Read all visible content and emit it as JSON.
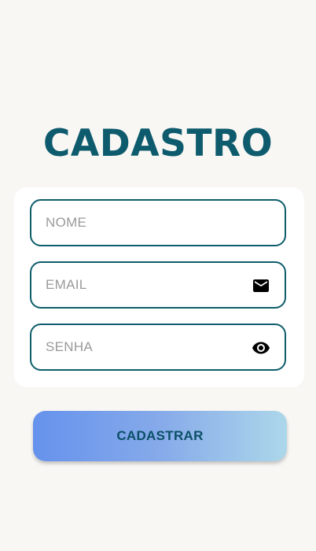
{
  "page": {
    "title": "CADASTRO"
  },
  "form": {
    "name_field": {
      "placeholder": "NOME",
      "value": ""
    },
    "email_field": {
      "placeholder": "EMAIL",
      "value": "",
      "icon": "mail-icon"
    },
    "password_field": {
      "placeholder": "SENHA",
      "value": "",
      "icon": "eye-icon"
    }
  },
  "actions": {
    "submit_label": "CADASTRAR"
  },
  "colors": {
    "background": "#f9f7f4",
    "title": "#0d5b6d",
    "field_border": "#0f5d6b",
    "button_gradient_start": "#6592ec",
    "button_gradient_end": "#acd7ea",
    "button_text": "#0b4f66"
  }
}
